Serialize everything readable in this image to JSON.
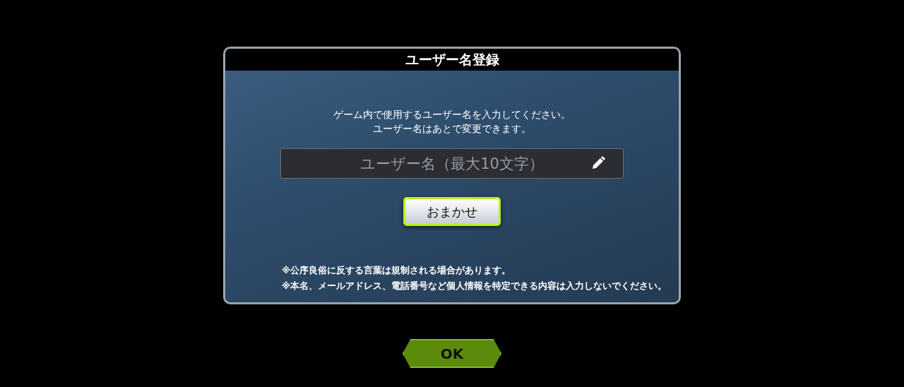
{
  "dialog": {
    "title": "ユーザー名登録",
    "message": [
      "ゲーム内で使用するユーザー名を入力してください。",
      "ユーザー名はあとで変更できます。"
    ],
    "name_field": {
      "placeholder": "ユーザー名（最大10文字）"
    },
    "random_button": "おまかせ",
    "notes": [
      "※公序良俗に反する言葉は規制される場合があります。",
      "※本名、メールアドレス、電話番号など個人情報を特定できる内容は入力しないでください。"
    ]
  },
  "ok_button": "OK"
}
